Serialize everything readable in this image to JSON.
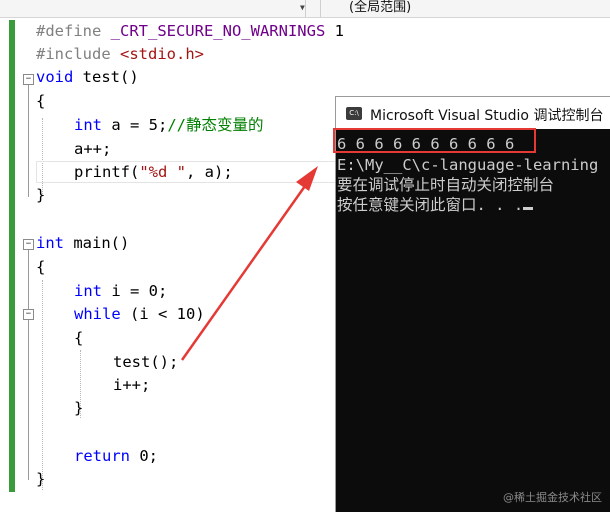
{
  "toolbar": {
    "scope": "(全局范围)"
  },
  "code": {
    "lines": [
      {
        "pp": "#define ",
        "macro": "_CRT_SECURE_NO_WARNINGS",
        "rest": " 1"
      },
      {
        "pp": "#include ",
        "inc": "<stdio.h>"
      },
      {
        "kw": "void",
        "rest": " test()"
      },
      {
        "rest": "{"
      },
      {
        "kw": "int",
        "rest": " a = 5;",
        "cm": "//静态变量的"
      },
      {
        "rest": "a++;"
      },
      {
        "fn": "printf(",
        "str": "\"%d \"",
        "rest": ", a);"
      },
      {
        "rest": "}"
      },
      {
        "kw": "int",
        "rest": " main()"
      },
      {
        "rest": "{"
      },
      {
        "kw": "int",
        "rest": " i = 0;"
      },
      {
        "kw": "while",
        "rest": " (i < 10)"
      },
      {
        "rest": "{"
      },
      {
        "rest": "test();"
      },
      {
        "rest": "i++;"
      },
      {
        "rest": "}"
      },
      {
        "kw": "return",
        "rest": " 0;"
      },
      {
        "rest": "}"
      }
    ]
  },
  "console": {
    "title": "Microsoft Visual Studio 调试控制台",
    "icon_label": "C:\\",
    "lines": [
      "6 6 6 6 6 6 6 6 6 6",
      "E:\\My__C\\c-language-learning",
      "要在调试停止时自动关闭控制台",
      "按任意键关闭此窗口. . ."
    ]
  },
  "annotation": {
    "color": "#e53935"
  },
  "watermark": "@稀土掘金技术社区"
}
